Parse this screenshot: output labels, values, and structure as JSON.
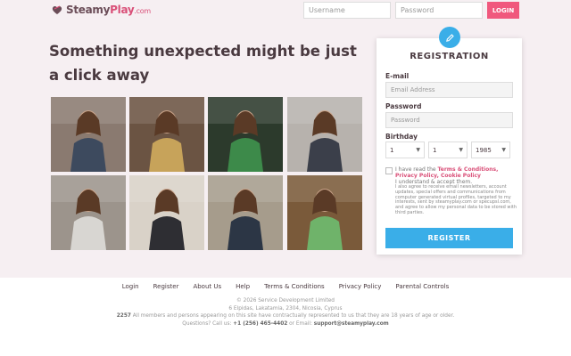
{
  "brand": {
    "name_prefix": "Steamy",
    "name_accent": "Play",
    "name_suffix": ".com",
    "accent_color": "#d94f78"
  },
  "header": {
    "username_placeholder": "Username",
    "password_placeholder": "Password",
    "login_label": "LOGIN"
  },
  "hero": {
    "headline": "Something unexpected might be just a click away"
  },
  "registration": {
    "title": "REGISTRATION",
    "email_label": "E-mail",
    "email_placeholder": "Email Address",
    "password_label": "Password",
    "password_placeholder": "Password",
    "birthday_label": "Birthday",
    "birthday_day": "1",
    "birthday_month": "1",
    "birthday_year": "1985",
    "terms_prefix": "I have read the ",
    "terms_link": "Terms & Conditions",
    "terms_sep": ", ",
    "privacy_link": "Privacy Policy",
    "terms_sep2": ", ",
    "cookie_link": "Cookie Policy",
    "terms_suffix": "I understand & accept them.",
    "fine_print": "I also agree to receive email newsletters, account updates, special offers and communications from computer generated virtual profiles, targeted to my interests, sent by steamyplay.com or specupsl.com, and agree to allow my personal data to be stored with third parties.",
    "register_label": "REGISTER",
    "button_color": "#3aaee8"
  },
  "footer": {
    "links": [
      "Login",
      "Register",
      "About Us",
      "Help",
      "Terms & Conditions",
      "Privacy Policy",
      "Parental Controls"
    ],
    "copyright": "© 2026 Service Development Limited",
    "address": "6 Elpidas, Lakatamia, 2304, Nicosia, Cyprus",
    "disclaimer_code": "2257",
    "disclaimer": " All members and persons appearing on this site have contractually represented to us that they are 18 years of age or older.",
    "contact_prefix": "Questions? Call us: ",
    "phone": "+1 (256) 465-4402",
    "contact_mid": " or Email: ",
    "email": "support@steamyplay.com"
  },
  "gallery": {
    "photos": [
      {
        "name": "photo-1",
        "bg": "#8a7a70",
        "fig": "#3d4a5e"
      },
      {
        "name": "photo-2",
        "bg": "#6b5443",
        "fig": "#c7a35a"
      },
      {
        "name": "photo-3",
        "bg": "#2c3a2c",
        "fig": "#3d8a4a"
      },
      {
        "name": "photo-4",
        "bg": "#b7b2ad",
        "fig": "#3b3f4a"
      },
      {
        "name": "photo-5",
        "bg": "#9c948c",
        "fig": "#d8d6d2"
      },
      {
        "name": "photo-6",
        "bg": "#d9d2c8",
        "fig": "#2e2e33"
      },
      {
        "name": "photo-7",
        "bg": "#a69c8c",
        "fig": "#2c3645"
      },
      {
        "name": "photo-8",
        "bg": "#7a5a3a",
        "fig": "#6fb36a"
      }
    ]
  }
}
